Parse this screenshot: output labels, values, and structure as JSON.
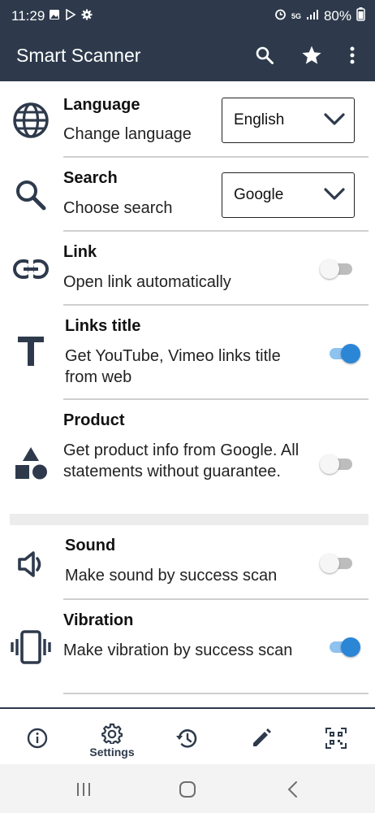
{
  "status_bar": {
    "time": "11:29",
    "network": "5G",
    "battery": "80%"
  },
  "app_bar": {
    "title": "Smart Scanner",
    "actions": [
      "search-icon",
      "star-icon",
      "more-vert-icon"
    ]
  },
  "settings": {
    "language": {
      "title": "Language",
      "subtitle": "Change language",
      "value": "English"
    },
    "search": {
      "title": "Search",
      "subtitle": "Choose search",
      "value": "Google"
    },
    "link": {
      "title": "Link",
      "subtitle": "Open link automatically",
      "enabled": false
    },
    "links_title": {
      "title": "Links title",
      "subtitle": "Get YouTube, Vimeo links title from web",
      "enabled": true
    },
    "product": {
      "title": "Product",
      "subtitle": "Get product info from Google. All statements without guarantee.",
      "enabled": false
    },
    "sound": {
      "title": "Sound",
      "subtitle": "Make sound by success scan",
      "enabled": false
    },
    "vibration": {
      "title": "Vibration",
      "subtitle": "Make vibration by success scan",
      "enabled": true
    }
  },
  "bottom_nav": {
    "settings_label": "Settings",
    "items": [
      "info-icon",
      "settings-icon",
      "history-icon",
      "edit-icon",
      "qr-code-icon"
    ]
  },
  "colors": {
    "primary": "#2e3a4c",
    "accent": "#2b86d6"
  }
}
